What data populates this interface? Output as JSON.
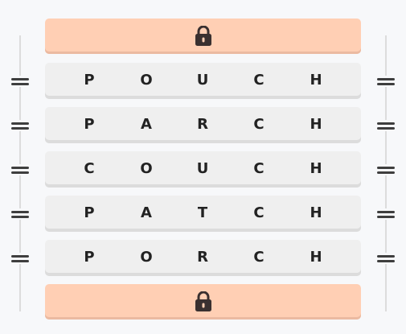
{
  "rows": [
    {
      "letters": [
        "P",
        "O",
        "U",
        "C",
        "H"
      ]
    },
    {
      "letters": [
        "P",
        "A",
        "R",
        "C",
        "H"
      ]
    },
    {
      "letters": [
        "C",
        "O",
        "U",
        "C",
        "H"
      ]
    },
    {
      "letters": [
        "P",
        "A",
        "T",
        "C",
        "H"
      ]
    },
    {
      "letters": [
        "P",
        "O",
        "R",
        "C",
        "H"
      ]
    }
  ],
  "icons": {
    "top_lock": "lock-icon",
    "bottom_lock": "lock-icon",
    "handle": "drag-handle-icon"
  },
  "colors": {
    "lock_bar": "#ffcfb4",
    "row_bg": "#efefef",
    "text": "#222222"
  }
}
